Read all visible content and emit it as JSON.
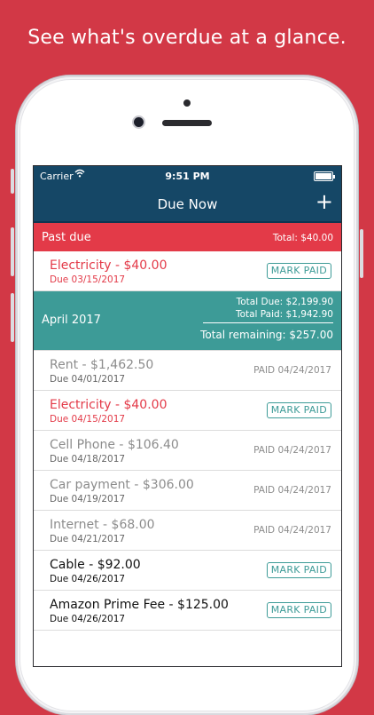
{
  "headline": "See what's overdue at a glance.",
  "status_bar": {
    "carrier": "Carrier",
    "time": "9:51 PM"
  },
  "nav": {
    "title": "Due Now",
    "add_label": "+"
  },
  "past_due": {
    "label": "Past due",
    "total": "Total: $40.00",
    "items": [
      {
        "name": "Electricity - $40.00",
        "due": "Due 03/15/2017",
        "action": "MARK PAID"
      }
    ]
  },
  "month": {
    "label": "April 2017",
    "total_due": "Total Due: $2,199.90",
    "total_paid": "Total Paid: $1,942.90",
    "total_remaining": "Total remaining: $257.00",
    "items": [
      {
        "name": "Rent - $1,462.50",
        "due": "Due 04/01/2017",
        "status": "PAID 04/24/2017"
      },
      {
        "name": "Electricity - $40.00",
        "due": "Due 04/15/2017",
        "action": "MARK PAID"
      },
      {
        "name": "Cell Phone - $106.40",
        "due": "Due 04/18/2017",
        "status": "PAID 04/24/2017"
      },
      {
        "name": "Car payment - $306.00",
        "due": "Due 04/19/2017",
        "status": "PAID 04/24/2017"
      },
      {
        "name": "Internet - $68.00",
        "due": "Due 04/21/2017",
        "status": "PAID 04/24/2017"
      },
      {
        "name": "Cable - $92.00",
        "due": "Due 04/26/2017",
        "action": "MARK PAID"
      },
      {
        "name": "Amazon Prime Fee - $125.00",
        "due": "Due 04/26/2017",
        "action": "MARK PAID"
      }
    ]
  },
  "colors": {
    "background": "#d23846",
    "nav": "#154766",
    "past_due": "#e33a48",
    "month_header": "#3d9b97",
    "overdue_text": "#e33a48",
    "paid_text": "#8c8c8c"
  }
}
